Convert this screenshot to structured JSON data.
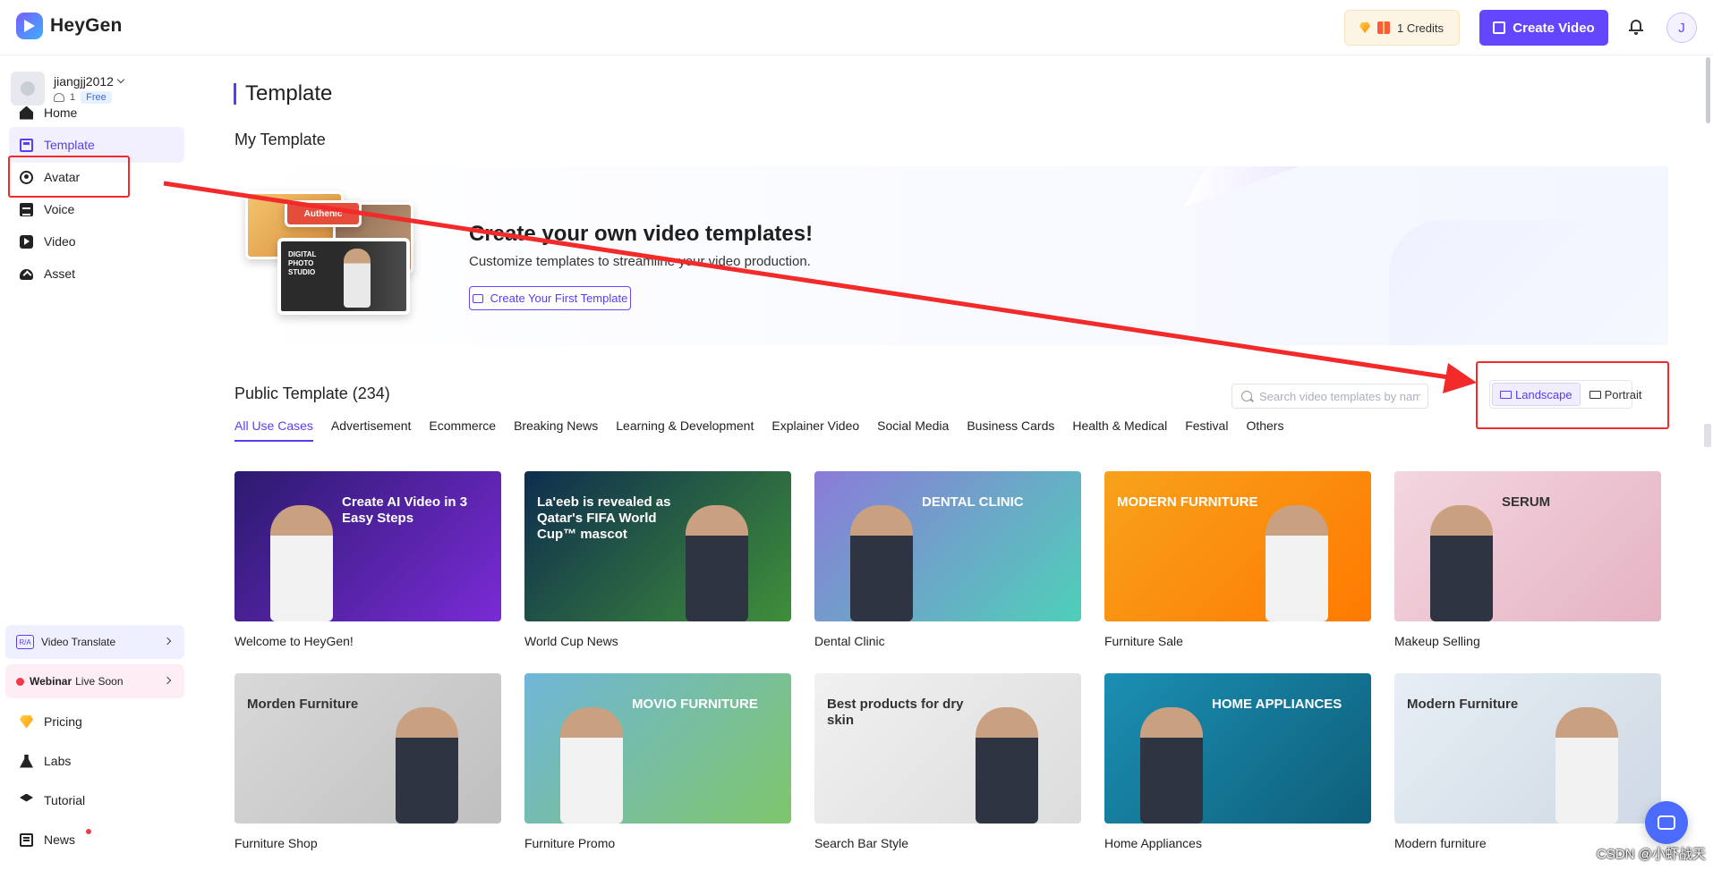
{
  "header": {
    "brand": "HeyGen",
    "credits_label": "1 Credits",
    "create_video_label": "Create Video",
    "avatar_initial": "J"
  },
  "account": {
    "username": "jiangjj2012",
    "member_count": "1",
    "plan": "Free"
  },
  "sidebar": {
    "items": [
      {
        "label": "Home",
        "icon": "home-icon"
      },
      {
        "label": "Template",
        "icon": "template-icon"
      },
      {
        "label": "Avatar",
        "icon": "avatar-icon"
      },
      {
        "label": "Voice",
        "icon": "voice-icon"
      },
      {
        "label": "Video",
        "icon": "video-icon"
      },
      {
        "label": "Asset",
        "icon": "asset-icon"
      }
    ],
    "promos": {
      "translate_label": "Video Translate",
      "translate_icon_text": "R/A",
      "webinar_strong": "Webinar",
      "webinar_rest": "Live Soon"
    },
    "bottom_items": [
      {
        "label": "Pricing",
        "icon": "pricing-icon"
      },
      {
        "label": "Labs",
        "icon": "labs-icon"
      },
      {
        "label": "Tutorial",
        "icon": "tutorial-icon"
      },
      {
        "label": "News",
        "icon": "news-icon"
      }
    ]
  },
  "main": {
    "page_title": "Template",
    "my_template_title": "My Template",
    "banner": {
      "heading": "Create your own video templates!",
      "subheading": "Customize templates to streamline your video production.",
      "button_label": "Create Your First Template",
      "card_authentic": "Authenic",
      "card_studio": "DIGITAL PHOTO STUDIO"
    },
    "public_title": "Public Template (234)",
    "search": {
      "placeholder": "Search video templates by name",
      "value": ""
    },
    "orientation": {
      "landscape_label": "Landscape",
      "portrait_label": "Portrait",
      "selected": "Landscape"
    },
    "tabs": [
      {
        "label": "All Use Cases"
      },
      {
        "label": "Advertisement"
      },
      {
        "label": "Ecommerce"
      },
      {
        "label": "Breaking News"
      },
      {
        "label": "Learning & Development"
      },
      {
        "label": "Explainer Video"
      },
      {
        "label": "Social Media"
      },
      {
        "label": "Business Cards"
      },
      {
        "label": "Health & Medical"
      },
      {
        "label": "Festival"
      },
      {
        "label": "Others"
      }
    ],
    "templates": [
      {
        "name": "Welcome to HeyGen!",
        "overlay": "Create AI Video in 3 Easy Steps",
        "colors": [
          "#2b1a6e",
          "#7a2bd6"
        ]
      },
      {
        "name": "World Cup News",
        "overlay": "La'eeb is revealed as Qatar's FIFA World Cup™ mascot",
        "colors": [
          "#0e2d4e",
          "#3f8f3a"
        ]
      },
      {
        "name": "Dental Clinic",
        "overlay": "DENTAL CLINIC",
        "colors": [
          "#8b7bd8",
          "#4ed0b8"
        ]
      },
      {
        "name": "Furniture Sale",
        "overlay": "MODERN FURNITURE",
        "colors": [
          "#f7a21b",
          "#ff7a00"
        ]
      },
      {
        "name": "Makeup Selling",
        "overlay": "SERUM",
        "colors": [
          "#f3d6df",
          "#e5b3c3"
        ]
      },
      {
        "name": "Furniture Shop",
        "overlay": "Morden Furniture",
        "colors": [
          "#d9d9d9",
          "#bfbfbf"
        ]
      },
      {
        "name": "Furniture Promo",
        "overlay": "MOVIO FURNITURE",
        "colors": [
          "#6fb6d9",
          "#7fc66b"
        ]
      },
      {
        "name": "Search Bar Style",
        "overlay": "Best products for dry skin",
        "colors": [
          "#f1f1f1",
          "#dcdcdc"
        ]
      },
      {
        "name": "Home Appliances",
        "overlay": "HOME APPLIANCES",
        "colors": [
          "#1b8fb3",
          "#0e5f7a"
        ]
      },
      {
        "name": "Modern furniture",
        "overlay": "Modern Furniture",
        "colors": [
          "#e7eef5",
          "#cfd9e4"
        ]
      }
    ]
  },
  "watermark": "CSDN @小虾战天",
  "colors": {
    "accent": "#6446ff",
    "annotation": "#f22a2a"
  }
}
